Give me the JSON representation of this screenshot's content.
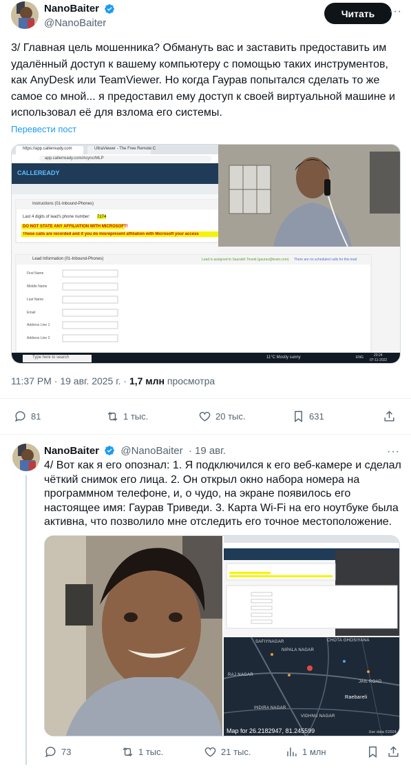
{
  "post1": {
    "display_name": "NanoBaiter",
    "handle": "@NanoBaiter",
    "follow_label": "Читать",
    "more": "···",
    "text": "3/ Главная цель мошенника? Обмануть вас и заставить предоставить им удалённый доступ к вашему компьютеру с помощью таких инструментов, как AnyDesk или TeamViewer. Но когда Гаурав попытался сделать то же самое со мной... я предоставил ему доступ к своей виртуальной машине и использовал её для взлома его системы.",
    "translate": "Перевести пост",
    "time": "11:37 PM · 19 авг. 2025 г. · ",
    "views": "1,7 млн",
    "views_label": "просмотра",
    "replies": "81",
    "reposts": "1 тыс.",
    "likes": "20 тыс.",
    "bookmarks": "631"
  },
  "screenshot1": {
    "tab1": "https://app.callerready.com",
    "tab2": "UltraViewer - The Free Remote C",
    "url": "app.callerready.com/Async/MLP",
    "logo": "CALLEREADY",
    "instructions_title": "Instructions (01-Inbound-Phones)",
    "last4": "Last 4 digits of lead's phone number:",
    "last4_value": "7274",
    "warn1": "DO NOT STATE ANY AFFILIATION WITH MICROSOFT!",
    "warn2": "These calls are recorded and if you do misrepresent affiliation with Microsoft your access",
    "lead_title": "Lead Information (01-Inbound-Phones)",
    "assigned": "Lead is assigned to Saurabh Trivedi (gaurav@team.com)",
    "no_calls": "There are no scheduled calls for this lead",
    "fields": [
      "First Name",
      "Middle Name",
      "Last Name",
      "Email",
      "Address Line 1",
      "Address Line 2"
    ],
    "search_placeholder": "Type here to search",
    "weather": "11°C  Mostly sunny",
    "lang": "ENG",
    "clock": "23:24",
    "date": "07-11-2022"
  },
  "post2": {
    "display_name": "NanoBaiter",
    "handle": "@NanoBaiter",
    "date": "· 19 авг.",
    "more": "···",
    "text": "4/ Вот как я его опознал: 1. Я подключился к его веб-камере и сделал чёткий снимок его лица. 2. Он открыл окно набора номера на программном телефоне, и, о чудо, на экране появилось его настоящее имя: Гаурав Триведи. 3. Карта Wi-Fi на его ноутбуке была активна, что позволило мне отследить его точное местоположение.",
    "replies": "73",
    "reposts": "1 тыс.",
    "likes": "21 тыс.",
    "views": "1 млн"
  },
  "map": {
    "caption": "Map for 26.2182947, 81.245599",
    "labels": [
      "NIPALA NAGAR",
      "CHOTA GHOSIYANA",
      "INDIRA NAGAR",
      "VIDHNU NAGAR",
      "Raebareli",
      "RAJ NAGAR",
      "SAFIYNAGAR",
      "JAIL ROAD"
    ],
    "attribution": "Use data ©2024"
  },
  "colors": {
    "accent": "#1d9bf0",
    "text": "#0f1419",
    "muted": "#536471",
    "warn_bg": "#f5f500"
  }
}
